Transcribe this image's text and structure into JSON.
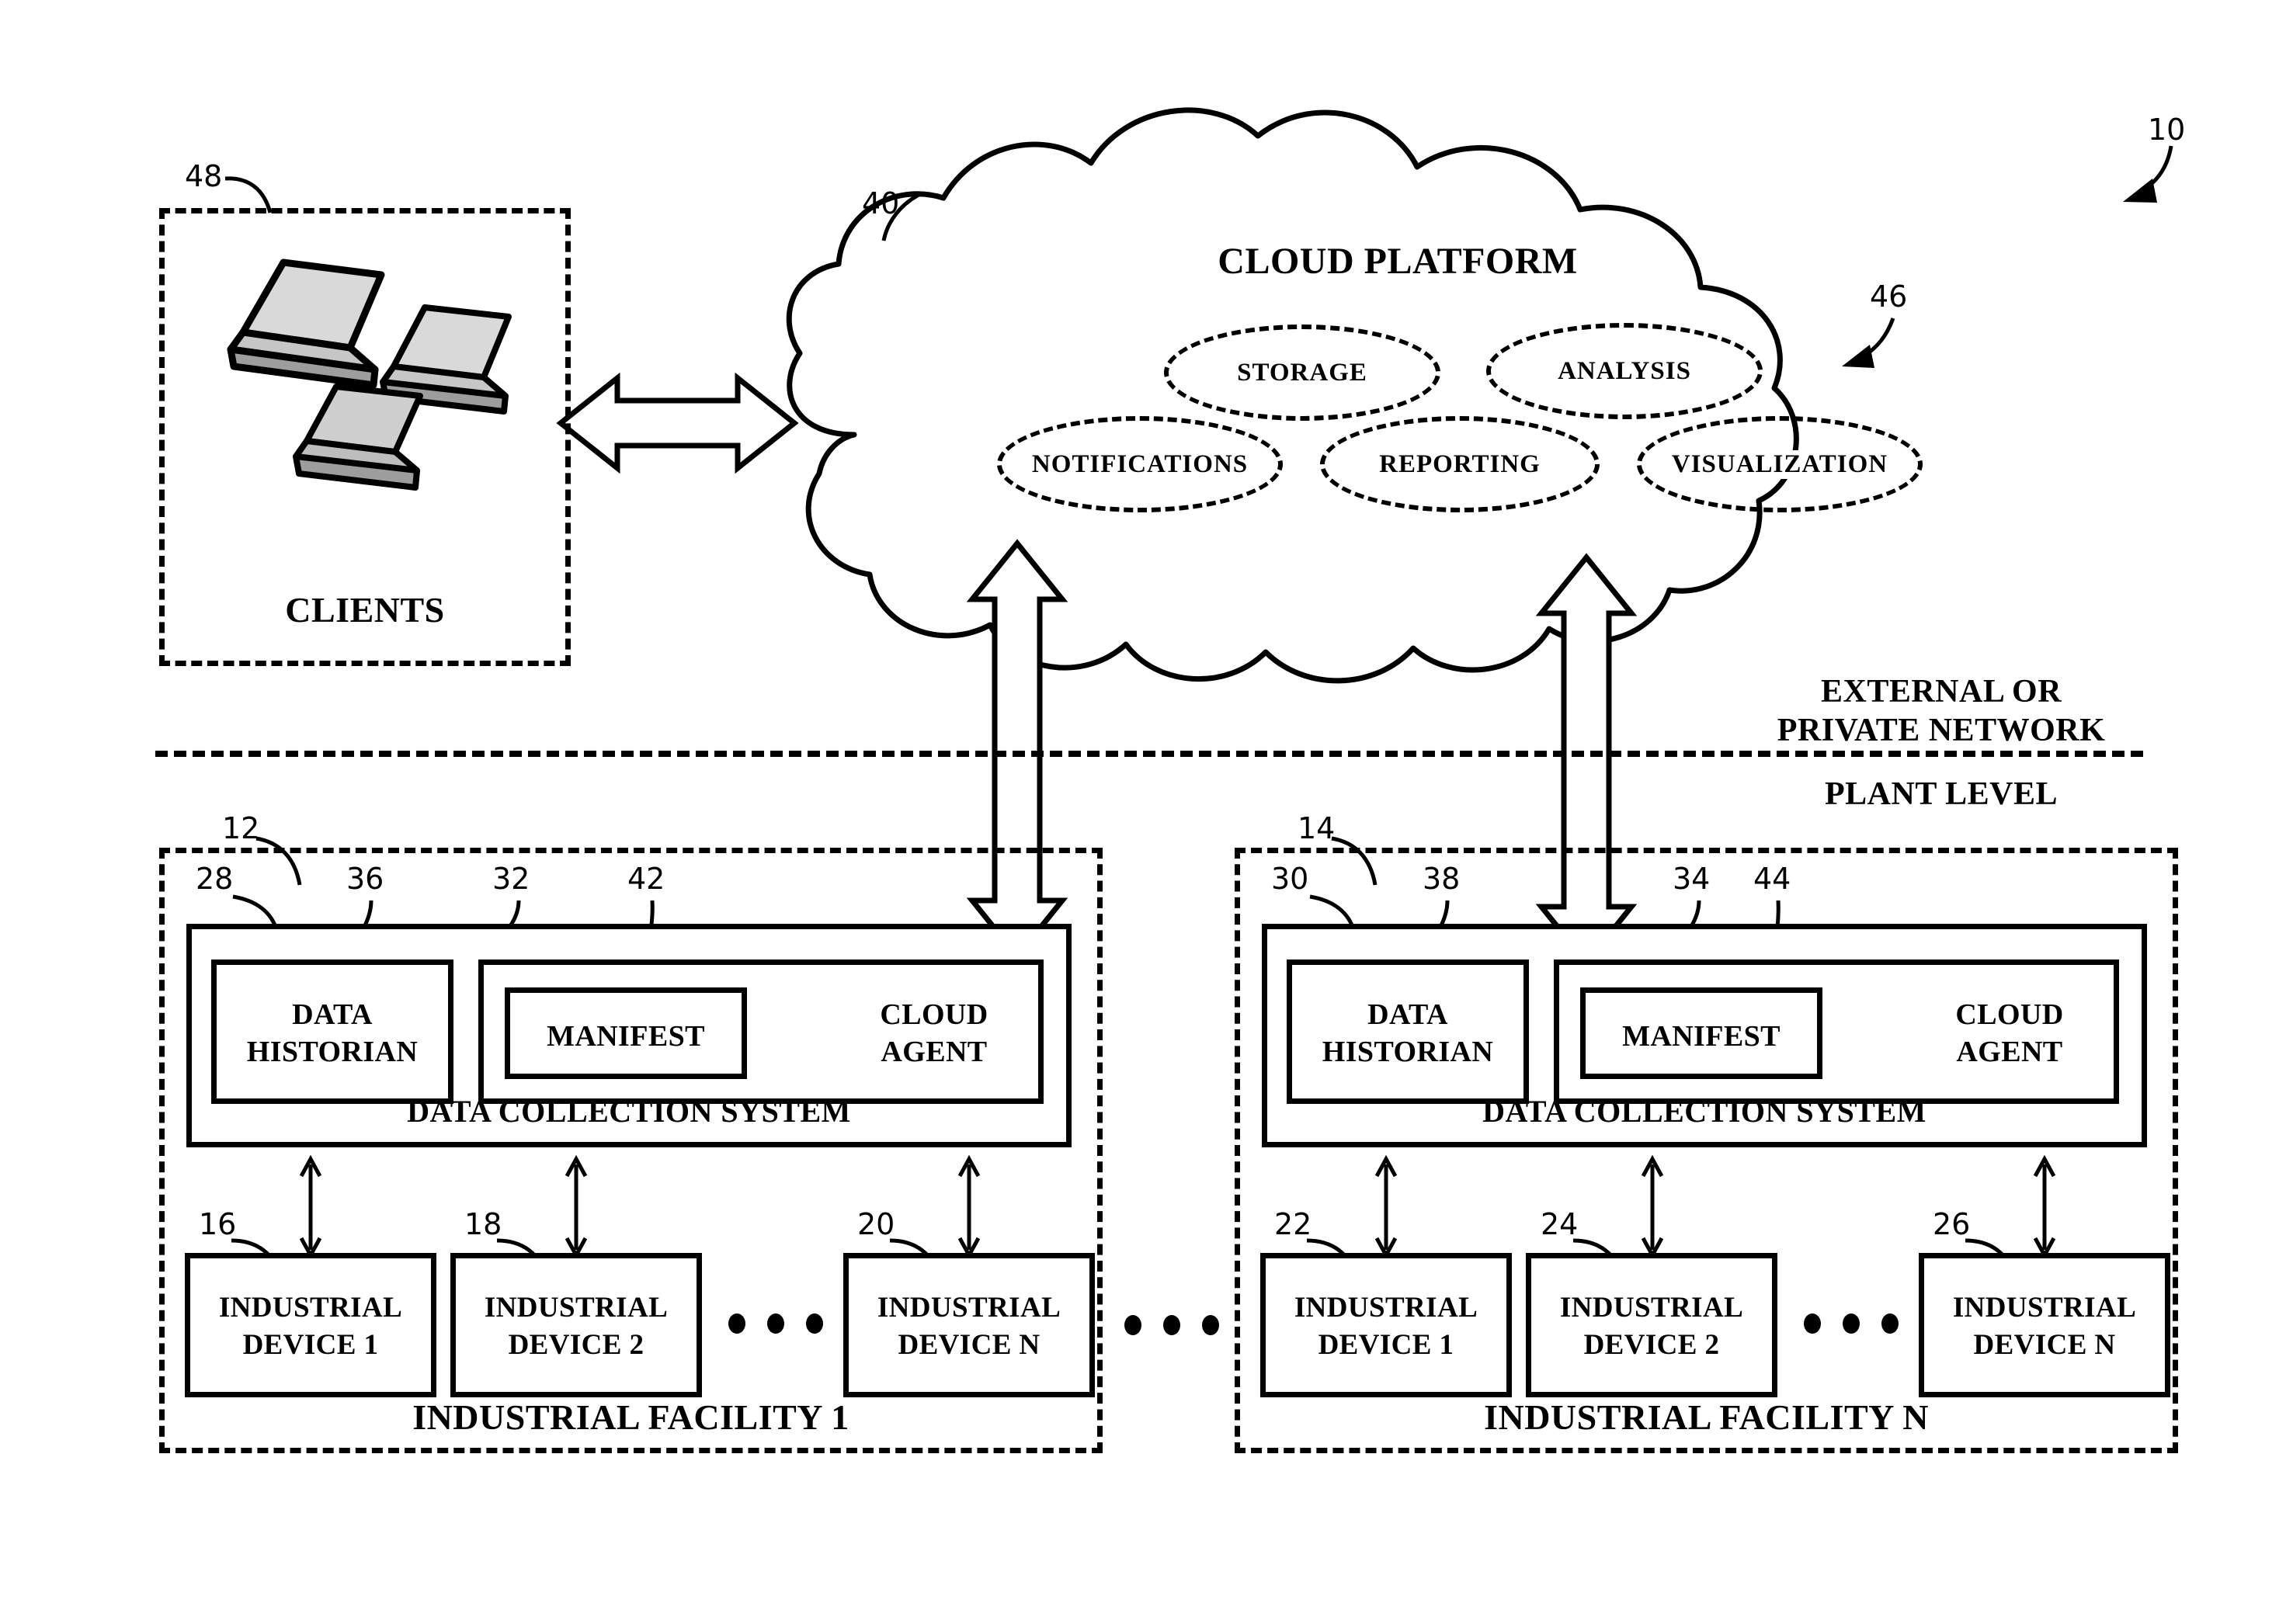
{
  "figure": {
    "system_ref": "10",
    "cloud": {
      "title": "CLOUD PLATFORM",
      "ref": "40",
      "services_ref": "46",
      "services": [
        {
          "label": "STORAGE"
        },
        {
          "label": "ANALYSIS"
        },
        {
          "label": "NOTIFICATIONS"
        },
        {
          "label": "REPORTING"
        },
        {
          "label": "VISUALIZATION"
        }
      ]
    },
    "clients": {
      "label": "CLIENTS",
      "ref": "48",
      "device_icon": "laptop-icon",
      "device_count": 3
    },
    "network_boundary": {
      "above_label_line1": "EXTERNAL OR",
      "above_label_line2": "PRIVATE NETWORK",
      "below_label": "PLANT LEVEL"
    },
    "facilities": [
      {
        "ref": "12",
        "label": "INDUSTRIAL FACILITY 1",
        "collection_system": {
          "label": "DATA COLLECTION SYSTEM",
          "ref": "28",
          "historian": {
            "label_line1": "DATA",
            "label_line2": "HISTORIAN",
            "ref": "36"
          },
          "cloud_agent": {
            "label_line1": "CLOUD",
            "label_line2": "AGENT",
            "ref": "32"
          },
          "manifest": {
            "label": "MANIFEST",
            "ref": "42"
          }
        },
        "devices": [
          {
            "ref": "16",
            "label_line1": "INDUSTRIAL",
            "label_line2": "DEVICE 1"
          },
          {
            "ref": "18",
            "label_line1": "INDUSTRIAL",
            "label_line2": "DEVICE 2"
          },
          {
            "ref": "20",
            "label_line1": "INDUSTRIAL",
            "label_line2": "DEVICE N"
          }
        ]
      },
      {
        "ref": "14",
        "label": "INDUSTRIAL FACILITY N",
        "collection_system": {
          "label": "DATA COLLECTION SYSTEM",
          "ref": "30",
          "historian": {
            "label_line1": "DATA",
            "label_line2": "HISTORIAN",
            "ref": "38"
          },
          "cloud_agent": {
            "label_line1": "CLOUD",
            "label_line2": "AGENT",
            "ref": "34"
          },
          "manifest": {
            "label": "MANIFEST",
            "ref": "44"
          }
        },
        "devices": [
          {
            "ref": "22",
            "label_line1": "INDUSTRIAL",
            "label_line2": "DEVICE 1"
          },
          {
            "ref": "24",
            "label_line1": "INDUSTRIAL",
            "label_line2": "DEVICE 2"
          },
          {
            "ref": "26",
            "label_line1": "INDUSTRIAL",
            "label_line2": "DEVICE N"
          }
        ]
      }
    ],
    "ellipsis_glyph": "• • •",
    "colors": {
      "line": "#000000",
      "background": "#ffffff"
    }
  }
}
